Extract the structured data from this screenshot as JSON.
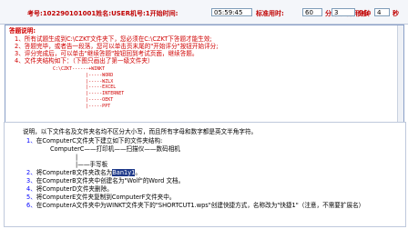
{
  "header": {
    "exam_label": "考号:",
    "exam_id": "102290101001",
    "name_label": "姓名:",
    "name_value": "USER",
    "machine_label": "机号:",
    "machine_value": "1",
    "start_time_label": "开始时间:",
    "start_time_value": "05:59:45",
    "std_time_label": "标准用时:",
    "std_time_value": "60",
    "std_unit": "分钟",
    "actual_time_label": "实际用时:",
    "actual_min_value": "3",
    "min_unit": "分钟",
    "actual_sec_value": "4",
    "sec_unit": "秒"
  },
  "instructions": {
    "title": "答题说明:",
    "lines": [
      "1、所有试题生成到C:\\CZKT文件夹下，您必须在C:\\CZKT下答题才能生效;",
      "2、答题完毕，或者告一段落，您可以单击页末尾的\"开始评分\"按钮开始评分;",
      "3、评分完成后，可以单击\"继续答题\"按钮回到考试页面，继续答题。",
      "4、文件夹结构如下：（下图只画出了第一级文件夹）"
    ],
    "tree": "C:\\CZKT------+WINKT\n            |-----WORD\n            |-----WZLX\n            |-----EXCEL\n            |-----INTERNET\n            |-----OEKT\n            |-----PPT"
  },
  "question": {
    "intro": "说明，以下文件名及文件夹名均不区分大小写，而且所有字母和数字都是英文半角字符。",
    "items": [
      {
        "num": "1、",
        "text": "在ComputerC文件夹下建立如下的文件夹结构:"
      },
      {
        "num": "",
        "text": "ComputerC——打印机——扫描仪——数码相机"
      },
      {
        "num": "",
        "text": "|"
      },
      {
        "num": "",
        "text": "|——手写板"
      },
      {
        "num": "2、",
        "text": "将ComputerB文件夹改名为",
        "highlight": "Ban1y1",
        "after": "。"
      },
      {
        "num": "3、",
        "text": "在ComputerB文件夹中创建名为\"Wolf\"的Word 文档。"
      },
      {
        "num": "4、",
        "text": "将ComputerD文件夹删除。"
      },
      {
        "num": "5、",
        "text": "将ComputerE文件夹复制到ComputerF文件夹中。"
      },
      {
        "num": "6、",
        "text": "在ComputerA文件夹中为WINKT文件夹下的\"SHORTCUT1.wps\"创建快捷方式，名称改为\"快捷1\"（注意，不需要扩展名）"
      }
    ]
  }
}
